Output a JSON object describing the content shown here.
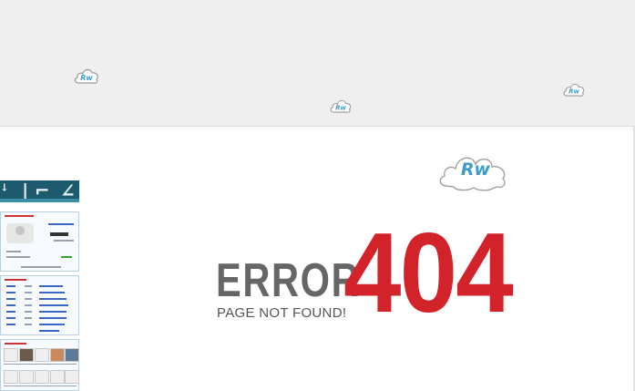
{
  "error_page": {
    "headline_word": "ERROR",
    "code": "404",
    "message": "PAGE NOT FOUND!"
  },
  "logo": {
    "text": "Rw",
    "icon": "cloud-logo-icon"
  },
  "colors": {
    "accent_red": "#d2232a",
    "text_gray": "#666666",
    "top_band": "#efefef",
    "logo_blue": "#3f9cc4"
  }
}
